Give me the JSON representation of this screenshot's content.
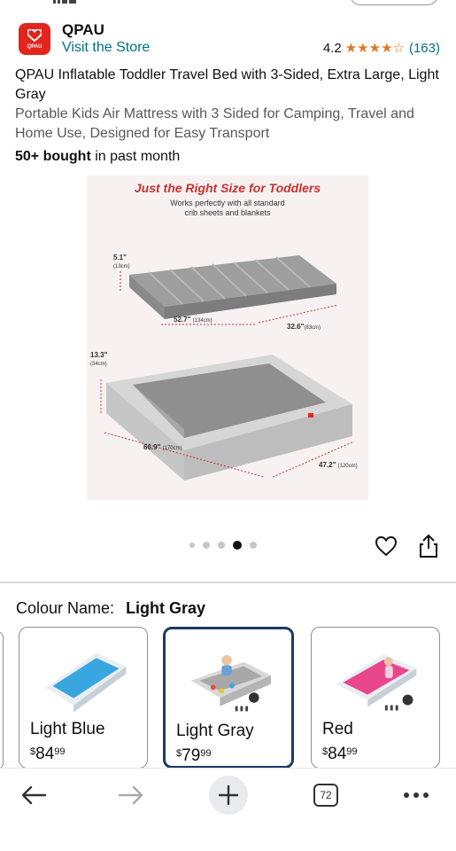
{
  "brand": {
    "name": "QPAU",
    "logo_text": "QPAU",
    "visit_store": "Visit the Store",
    "rating": "4.2",
    "stars": [
      1,
      1,
      1,
      1,
      0.5
    ],
    "rating_count": "(163)"
  },
  "product": {
    "title": "QPAU Inflatable Toddler Travel Bed with 3-Sided, Extra Large, Light Gray",
    "subtitle": "Portable Kids Air Mattress with 3 Sided for Camping, Travel and Home Use, Designed for Easy Transport",
    "bought_strong": "50+ bought",
    "bought_rest": " in past month"
  },
  "image": {
    "headline": "Just the Right Size for Toddlers",
    "subline_1": "Works perfectly with all standard",
    "subline_2": "crib sheets and blankets",
    "dim_height_1": "5.1\"",
    "dim_height_1_cm": "(13cm)",
    "dim_length_1": "52.7\"",
    "dim_length_1_cm": "(134cm)",
    "dim_width_1": "32.6\"",
    "dim_width_1_cm": "(83cm)",
    "dim_height_2": "13.3\"",
    "dim_height_2_cm": "(34cm)",
    "dim_length_2": "66.9\"",
    "dim_length_2_cm": "(170cm)",
    "dim_width_2": "47.2\"",
    "dim_width_2_cm": "(120cm)"
  },
  "carousel": {
    "dot_count": 5,
    "active_index": 3
  },
  "colour": {
    "label": "Colour Name:",
    "value": "Light Gray"
  },
  "swatches": [
    {
      "name": "Light Blue",
      "currency": "$",
      "whole": "84",
      "fraction": "99",
      "color": "#3aa6e0",
      "selected": false
    },
    {
      "name": "Light Gray",
      "currency": "$",
      "whole": "79",
      "fraction": "99",
      "color": "#c9c9c9",
      "selected": true
    },
    {
      "name": "Red",
      "currency": "$",
      "whole": "84",
      "fraction": "99",
      "color": "#e8478b",
      "selected": false
    }
  ],
  "nav": {
    "tab_count": "72"
  },
  "colors": {
    "link": "#007185",
    "star": "#de7921",
    "brand_red": "#e3251d",
    "selected_border": "#1c3a63"
  }
}
